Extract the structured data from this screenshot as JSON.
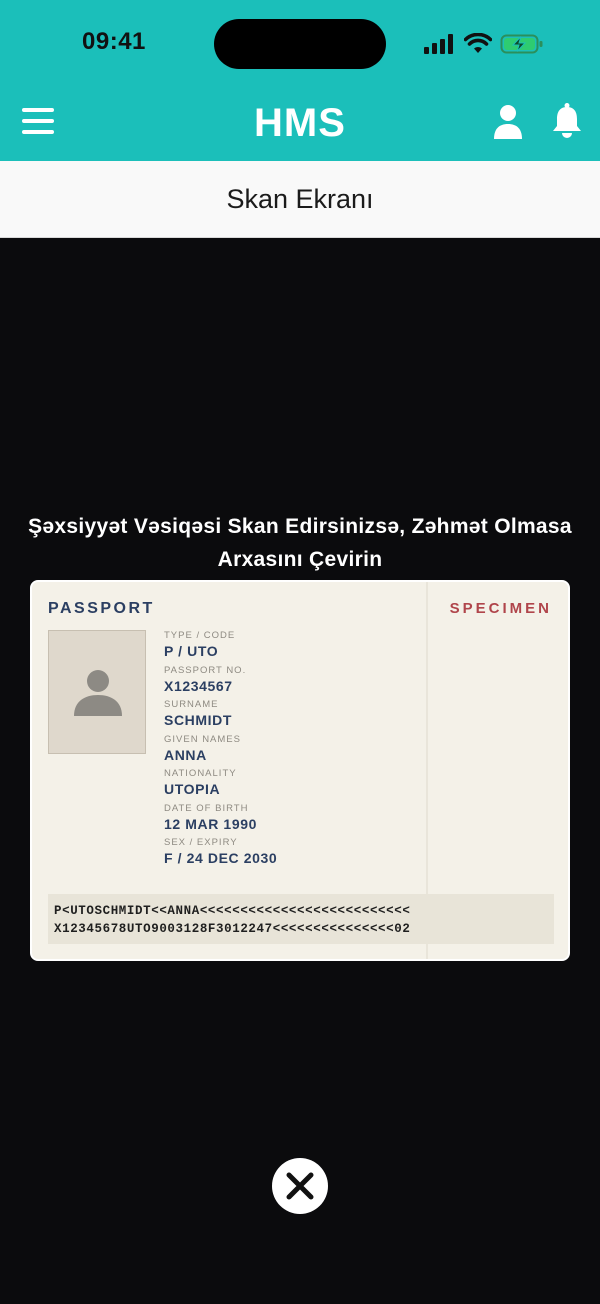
{
  "status_bar": {
    "time": "09:41",
    "signal_icon": "signal-bars-icon",
    "wifi_icon": "wifi-icon",
    "battery_icon": "battery-charging-icon",
    "battery_color": "#2ecc71"
  },
  "app_bar": {
    "logo_text": "HMS",
    "menu_icon": "hamburger-menu-icon",
    "profile_icon": "user-icon",
    "notification_icon": "bell-icon",
    "background_color": "#1bbfba"
  },
  "page": {
    "title": "Skan Ekranı"
  },
  "scanner": {
    "instruction_line1": "Şəxsiyyət Vəsiqəsi Skan Edirsinizsə, Zəhmət Olmasa",
    "instruction_line2": "Arxasını Çevirin",
    "close_icon": "close-icon"
  },
  "passport": {
    "heading": "PASSPORT",
    "watermark": "SPECIMEN",
    "fields": [
      {
        "label": "TYPE / CODE",
        "value": "P / UTO"
      },
      {
        "label": "PASSPORT NO.",
        "value": "X1234567"
      },
      {
        "label": "SURNAME",
        "value": "SCHMIDT"
      },
      {
        "label": "GIVEN NAMES",
        "value": "ANNA"
      },
      {
        "label": "NATIONALITY",
        "value": "UTOPIA"
      },
      {
        "label": "DATE OF BIRTH",
        "value": "12 MAR 1990"
      },
      {
        "label": "SEX / EXPIRY",
        "value": "F / 24 DEC 2030"
      }
    ],
    "mrz_line1": "P<UTOSCHMIDT<<ANNA<<<<<<<<<<<<<<<<<<<<<<<<<<",
    "mrz_line2": "X12345678UTO9003128F3012247<<<<<<<<<<<<<<<02"
  }
}
